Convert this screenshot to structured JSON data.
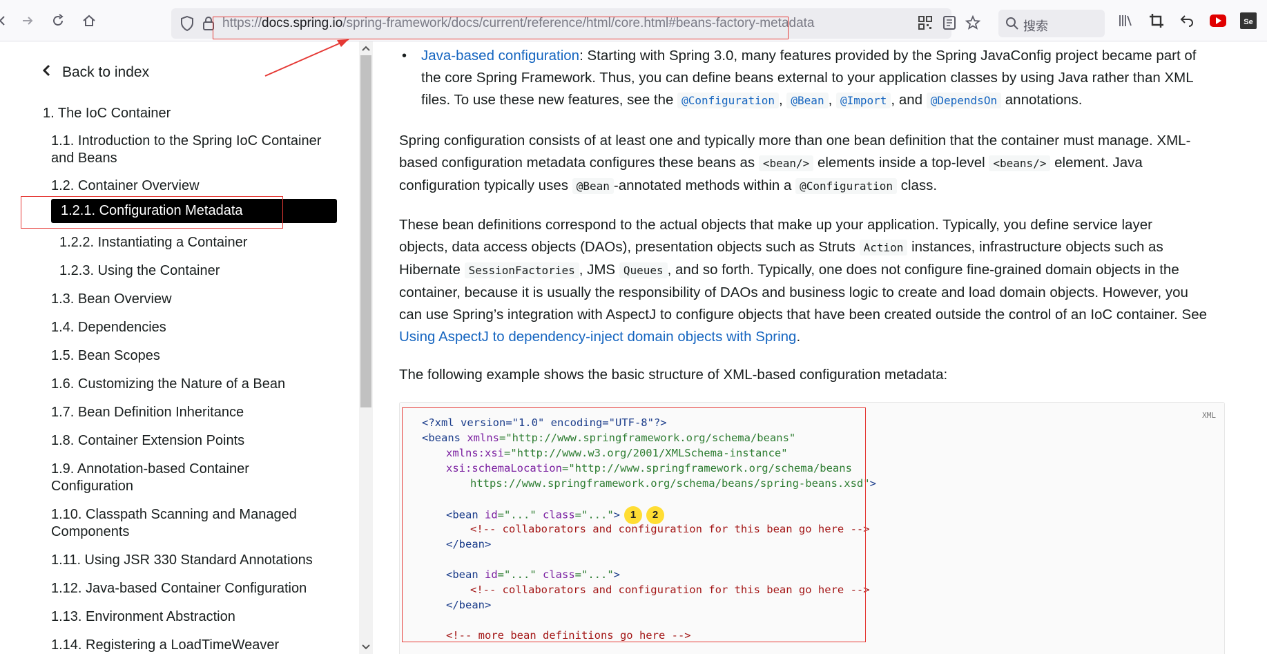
{
  "browser": {
    "url_host": "docs.spring.io",
    "url_prefix": "https://",
    "url_path": "/spring-framework/docs/current/reference/html/core.html#beans-factory-metadata",
    "search_placeholder": "搜索"
  },
  "sidebar": {
    "back_label": "Back to index",
    "items": [
      {
        "label": "1. The IoC Container"
      },
      {
        "label": "1.1. Introduction to the Spring IoC Container"
      },
      {
        "label": "and Beans"
      },
      {
        "label": "1.2. Container Overview"
      },
      {
        "label": "1.2.1. Configuration Metadata"
      },
      {
        "label": "1.2.2. Instantiating a Container"
      },
      {
        "label": "1.2.3. Using the Container"
      },
      {
        "label": "1.3. Bean Overview"
      },
      {
        "label": "1.4. Dependencies"
      },
      {
        "label": "1.5. Bean Scopes"
      },
      {
        "label": "1.6. Customizing the Nature of a Bean"
      },
      {
        "label": "1.7. Bean Definition Inheritance"
      },
      {
        "label": "1.8. Container Extension Points"
      },
      {
        "label": "1.9. Annotation-based Container"
      },
      {
        "label": "Configuration"
      },
      {
        "label": "1.10. Classpath Scanning and Managed"
      },
      {
        "label": "Components"
      },
      {
        "label": "1.11. Using JSR 330 Standard Annotations"
      },
      {
        "label": "1.12. Java-based Container Configuration"
      },
      {
        "label": "1.13. Environment Abstraction"
      },
      {
        "label": "1.14. Registering a LoadTimeWeaver"
      }
    ]
  },
  "main": {
    "bullet": {
      "link": "Java-based configuration",
      "text1": ": Starting with Spring 3.0, many features provided by the Spring JavaConfig project became part of",
      "text2": "the core Spring Framework. Thus, you can define beans external to your application classes by using Java rather than XML",
      "text3": "files. To use these new features, see the",
      "code1": "@Configuration",
      "code2": "@Bean",
      "code3": "@Import",
      "and": "and",
      "code4": "@DependsOn",
      "text4": "annotations."
    },
    "p1": {
      "l1": "Spring configuration consists of at least one and typically more than one bean definition that the container must manage. XML-",
      "l2a": "based configuration metadata configures these beans as",
      "code_bean": "<bean/>",
      "l2b": "elements inside a top-level",
      "code_beans": "<beans/>",
      "l2c": "element. Java",
      "l3a": "configuration typically uses",
      "code_atbean": "@Bean",
      "l3b": "-annotated methods within a",
      "code_atconf": "@Configuration",
      "l3c": "class."
    },
    "p2": {
      "l1": "These bean definitions correspond to the actual objects that make up your application. Typically, you define service layer",
      "l2a": "objects, data access objects (DAOs), presentation objects such as Struts",
      "code_action": "Action",
      "l2b": "instances, infrastructure objects such as",
      "l3a": "Hibernate",
      "code_sf": "SessionFactories",
      "l3b": ", JMS",
      "code_q": "Queues",
      "l3c": ", and so forth. Typically, one does not configure fine-grained domain objects in the",
      "l4": "container, because it is usually the responsibility of DAOs and business logic to create and load domain objects. However, you",
      "l5": "can use Spring’s integration with AspectJ to configure objects that have been created outside the control of an IoC container. See",
      "link": "Using AspectJ to dependency-inject domain objects with Spring",
      "end": "."
    },
    "p3": "The following example shows the basic structure of XML-based configuration metadata:",
    "code_lang": "XML",
    "code": {
      "l1": "<?xml version=\"1.0\" encoding=\"UTF-8\"?>",
      "l2_tag": "<beans",
      "l2_attr": " xmlns",
      "l2_val": "=\"http://www.springframework.org/schema/beans\"",
      "l3_attr": "xmlns:xsi",
      "l3_val": "=\"http://www.w3.org/2001/XMLSchema-instance\"",
      "l4_attr": "xsi:schemaLocation",
      "l4_val": "=\"http://www.springframework.org/schema/beans",
      "l5_val": "https://www.springframework.org/schema/beans/spring-beans.xsd\"",
      "l5_tag": ">",
      "bean_open_tag": "<bean",
      "bean_id_attr": " id",
      "bean_id_val": "=\"...\"",
      "bean_class_attr": " class",
      "bean_class_val": "=\"...\"",
      "bean_open_end": ">",
      "callout1": "1",
      "callout2": "2",
      "comment": "<!-- collaborators and configuration for this bean go here -->",
      "bean_close": "</bean>",
      "more_comment": "<!-- more bean definitions go here -->"
    }
  }
}
